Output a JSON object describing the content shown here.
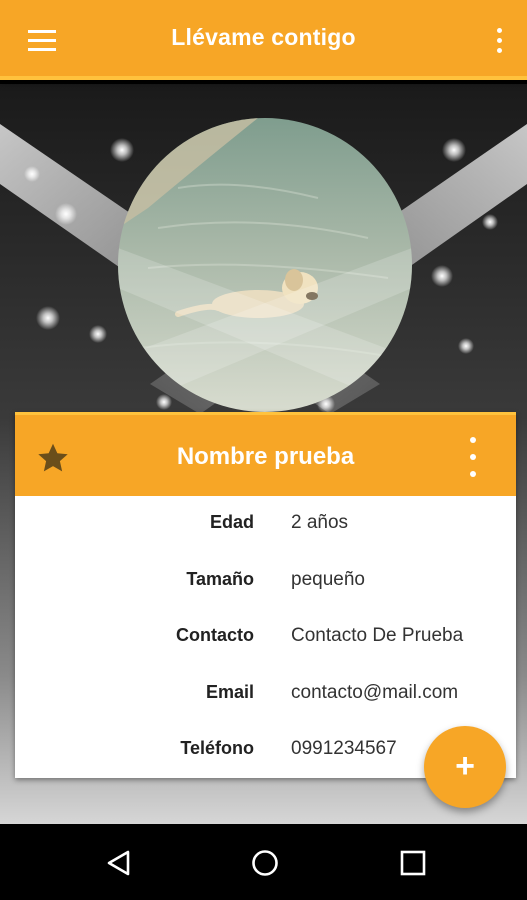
{
  "app_bar": {
    "title": "Llévame contigo",
    "menu_icon": "hamburger-menu-icon",
    "more_icon": "more-vert-icon"
  },
  "pet": {
    "name": "Nombre prueba",
    "favorite_icon": "star-icon",
    "more_icon": "more-vert-icon",
    "photo_description_icon": "dog-photo"
  },
  "details": [
    {
      "label": "Edad",
      "value": "2 años"
    },
    {
      "label": "Tamaño",
      "value": "pequeño"
    },
    {
      "label": "Contacto",
      "value": "Contacto De Prueba"
    },
    {
      "label": "Email",
      "value": "contacto@mail.com"
    },
    {
      "label": "Teléfono",
      "value": "0991234567"
    }
  ],
  "fab": {
    "label": "+"
  },
  "nav": {
    "back_icon": "back-triangle-icon",
    "home_icon": "home-circle-icon",
    "recents_icon": "recents-square-icon"
  },
  "colors": {
    "primary": "#f7a626",
    "accent_light": "#ffc23d",
    "star": "#6b4e1a"
  }
}
